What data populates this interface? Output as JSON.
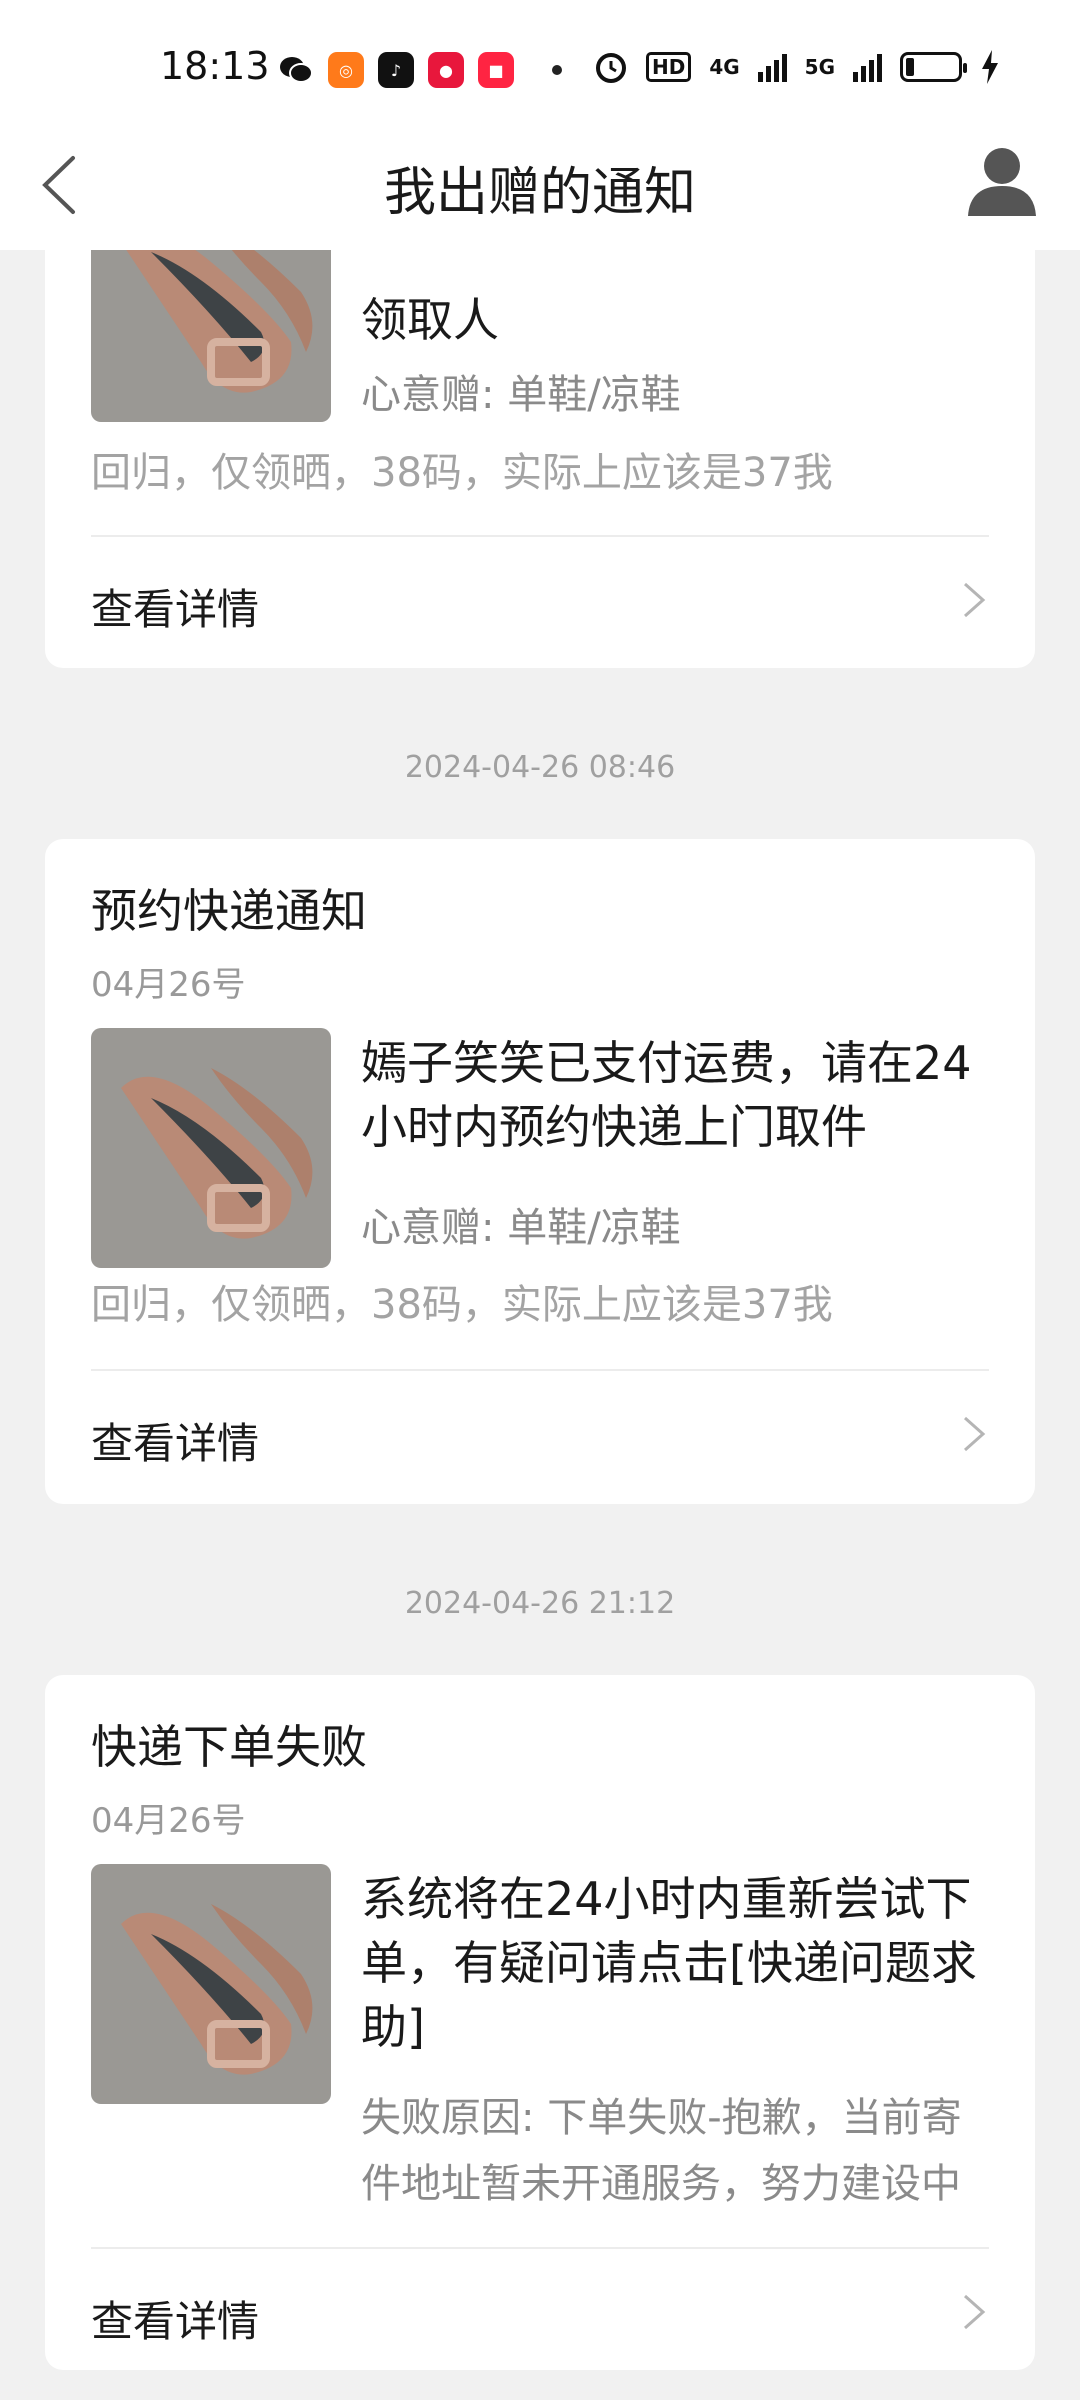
{
  "status_bar": {
    "time": "18:13",
    "network_hd": "HD",
    "network_4g": "4G",
    "network_5g": "5G"
  },
  "header": {
    "title": "我出赠的通知"
  },
  "cards": [
    {
      "title": "",
      "date": "",
      "message": "领取人",
      "gift": "心意赠: 单鞋/凉鞋",
      "description": "回归，仅领晒，38码，实际上应该是37我",
      "detail_label": "查看详情"
    },
    {
      "timestamp": "2024-04-26 08:46",
      "title": "预约快递通知",
      "date": "04月26号",
      "message": "嫣子笑笑已支付运费，请在24小时内预约快递上门取件",
      "gift": "心意赠: 单鞋/凉鞋",
      "description": "回归，仅领晒，38码，实际上应该是37我",
      "detail_label": "查看详情"
    },
    {
      "timestamp": "2024-04-26 21:12",
      "title": "快递下单失败",
      "date": "04月26号",
      "message": "系统将在24小时内重新尝试下单，有疑问请点击[快递问题求助]",
      "reason": "失败原因: 下单失败-抱歉，当前寄件地址暂未开通服务，努力建设中",
      "detail_label": "查看详情"
    }
  ],
  "colors": {
    "background": "#f1f1f1",
    "card": "#ffffff",
    "muted_text": "#8a8a8a"
  }
}
